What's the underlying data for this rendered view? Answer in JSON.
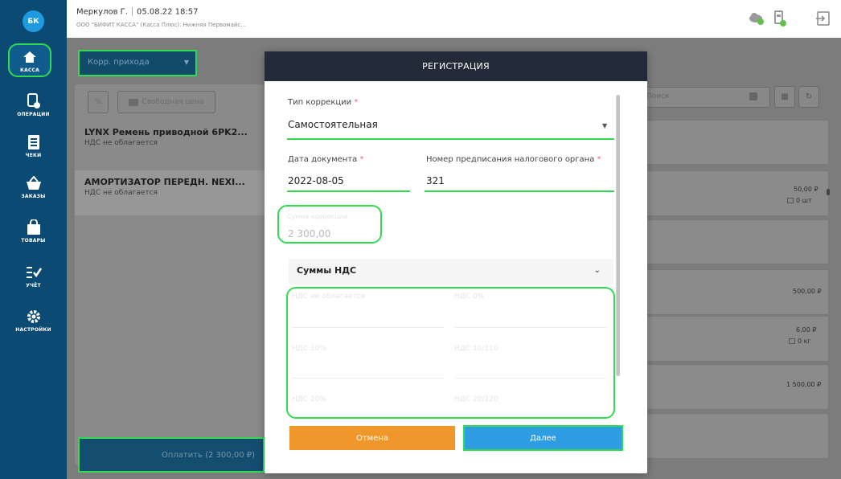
{
  "sidebar": {
    "logo": "БК",
    "items": [
      {
        "label": "КАССА",
        "icon": "home-icon"
      },
      {
        "label": "ОПЕРАЦИИ",
        "icon": "operations-icon"
      },
      {
        "label": "ЧЕКИ",
        "icon": "receipts-icon"
      },
      {
        "label": "ЗАКАЗЫ",
        "icon": "basket-icon"
      },
      {
        "label": "ТОВАРЫ",
        "icon": "bag-icon"
      },
      {
        "label": "УЧЁТ",
        "icon": "checklist-icon"
      },
      {
        "label": "НАСТРОЙКИ",
        "icon": "gear-icon"
      }
    ]
  },
  "header": {
    "user": "Меркулов Г.",
    "datetime": "05.08.22 18:57",
    "org": "ООО \"БИФИТ КАССА\" (Касса Плюс): Нижняя Первомайс..."
  },
  "background": {
    "correction_dropdown": "Корр. прихода",
    "free_price_button": "Свободная цена",
    "percent_button": "%",
    "search_placeholder": "Поиск",
    "items": [
      {
        "title": "LYNX Ремень приводной 6PK2...",
        "sub": "НДС не облагается"
      },
      {
        "title": "АМОРТИЗАТОР ПЕРЕДН. NEXI...",
        "sub": "НДС не облагается"
      }
    ],
    "pay_button": "Оплатить (2 300,00 ₽)",
    "prices": [
      {
        "price": "50,00 ₽",
        "qty": "0 шт"
      },
      {
        "price": "500,00 ₽",
        "qty": ""
      },
      {
        "price": "6,00 ₽",
        "qty": "0 кг"
      },
      {
        "price": "1 500,00 ₽",
        "qty": ""
      }
    ]
  },
  "modal": {
    "title": "РЕГИСТРАЦИЯ",
    "correction_type_label": "Тип коррекции",
    "correction_type_value": "Самостоятельная",
    "doc_date_label": "Дата документа",
    "doc_date_value": "2022-08-05",
    "tax_order_label": "Номер предписания налогового органа",
    "tax_order_value": "321",
    "sum_label": "Сумма коррекции",
    "sum_value": "2 300,00",
    "vat_section": "Суммы НДС",
    "vat_rows": [
      {
        "left": "НДС не облагается",
        "right": "НДС 0%"
      },
      {
        "left": "НДС 10%",
        "right": "НДС 10/110"
      },
      {
        "left": "НДС 20%",
        "right": "НДС 20/120"
      }
    ],
    "cancel_button": "Отмена",
    "next_button": "Далее",
    "required_mark": "*"
  }
}
